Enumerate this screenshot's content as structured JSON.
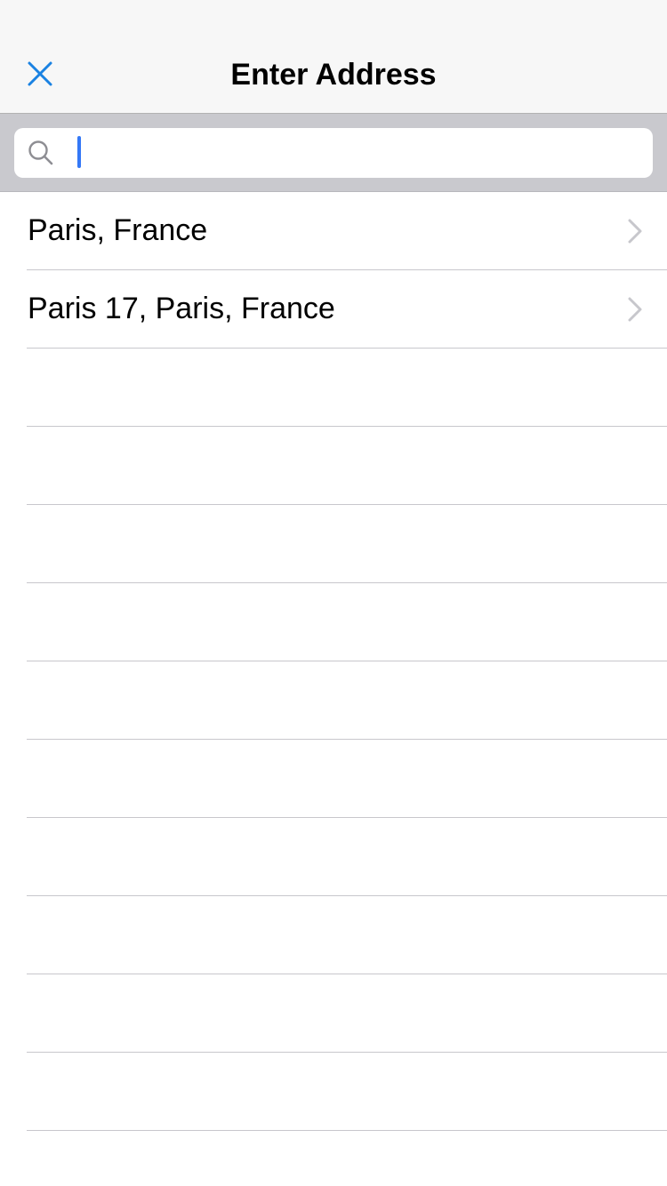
{
  "navbar": {
    "title": "Enter Address",
    "close_icon": "close-icon",
    "accent_color": "#1a82e2"
  },
  "search": {
    "value": "",
    "placeholder": "",
    "icon": "search-icon"
  },
  "results": [
    {
      "label": "Paris, France",
      "icon": "chevron-right-icon"
    },
    {
      "label": "Paris 17, Paris, France",
      "icon": "chevron-right-icon"
    }
  ],
  "empty_rows": 10
}
